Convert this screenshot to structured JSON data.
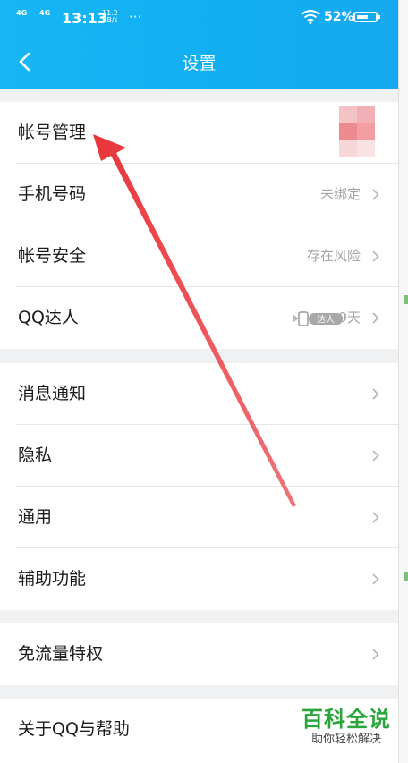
{
  "status_bar": {
    "network1": "4G",
    "network2": "4G",
    "time": "13:13",
    "speed_value": "11.2",
    "speed_unit": "KB/s",
    "more": "···",
    "battery": "52%"
  },
  "header": {
    "title": "设置",
    "back_icon": "chevron-left-icon"
  },
  "groups": [
    {
      "rows": [
        {
          "label": "帐号管理",
          "value": ""
        },
        {
          "label": "手机号码",
          "value": "未绑定"
        },
        {
          "label": "帐号安全",
          "value": "存在风险"
        },
        {
          "label": "QQ达人",
          "value": "9天",
          "badge": "达人"
        }
      ]
    },
    {
      "rows": [
        {
          "label": "消息通知"
        },
        {
          "label": "隐私"
        },
        {
          "label": "通用"
        },
        {
          "label": "辅助功能"
        }
      ]
    },
    {
      "rows": [
        {
          "label": "免流量特权"
        }
      ]
    },
    {
      "rows": [
        {
          "label": "关于QQ与帮助"
        }
      ]
    }
  ],
  "watermark": {
    "brand": "百科全说",
    "sub": "助你轻松解决"
  },
  "colors": {
    "header": "#14aef3",
    "arrow": "#e8353b",
    "brand": "#2aa63a",
    "value_text": "#a4a4a4"
  }
}
